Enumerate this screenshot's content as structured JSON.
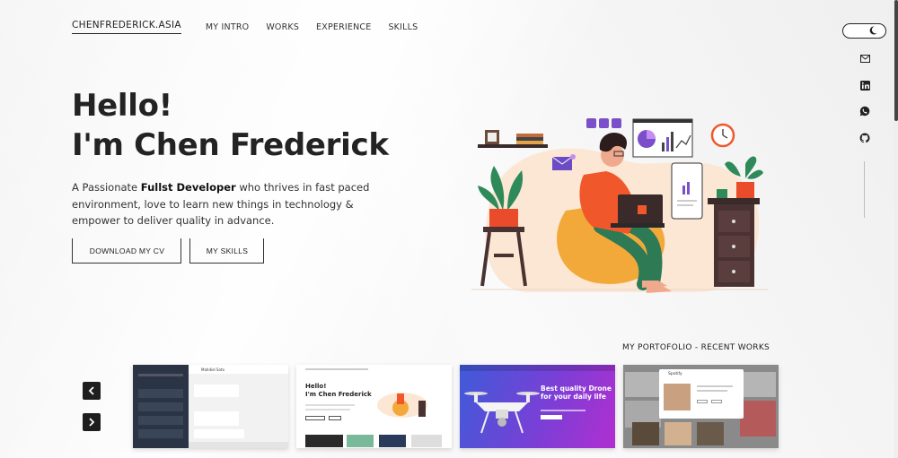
{
  "nav": {
    "brand": "CHENFREDERICK.ASIA",
    "links": [
      "MY INTRO",
      "WORKS",
      "EXPERIENCE",
      "SKILLS"
    ]
  },
  "icons": [
    "moon-icon",
    "mail-icon",
    "linkedin-icon",
    "whatsapp-icon",
    "github-icon",
    "chevron-left-icon",
    "chevron-right-icon"
  ],
  "hero": {
    "title_line1": "Hello!",
    "title_line2": "I'm Chen Frederick",
    "intro_prefix": "A Passionate ",
    "intro_highlight": "Fullst Developer",
    "intro_suffix": " who thrives in fast paced environment, love to learn new things in technology & empower to deliver quality in advance."
  },
  "buttons": {
    "download_cv": "DOWNLOAD MY CV",
    "my_skills": "MY SKILLS"
  },
  "portfolio": {
    "title": "MY PORTOFOLIO - RECENT WORKS",
    "cards": [
      {
        "name": "chat-app",
        "header": "Mahdiel Soto"
      },
      {
        "name": "portfolio-site",
        "title": "Hello!\nI'm Chen Frederick"
      },
      {
        "name": "drone-landing",
        "headline": "Best quality Drone for your daily life"
      },
      {
        "name": "video-call-app",
        "header": "Spotify"
      }
    ]
  },
  "colors": {
    "accent_dark": "#1e1e1e",
    "shirt_orange": "#f0582c",
    "beanbag": "#f3a93a",
    "purple": "#7b4fc9",
    "drone_gradient_start": "#3f5bd8",
    "drone_gradient_end": "#b02fd0"
  }
}
